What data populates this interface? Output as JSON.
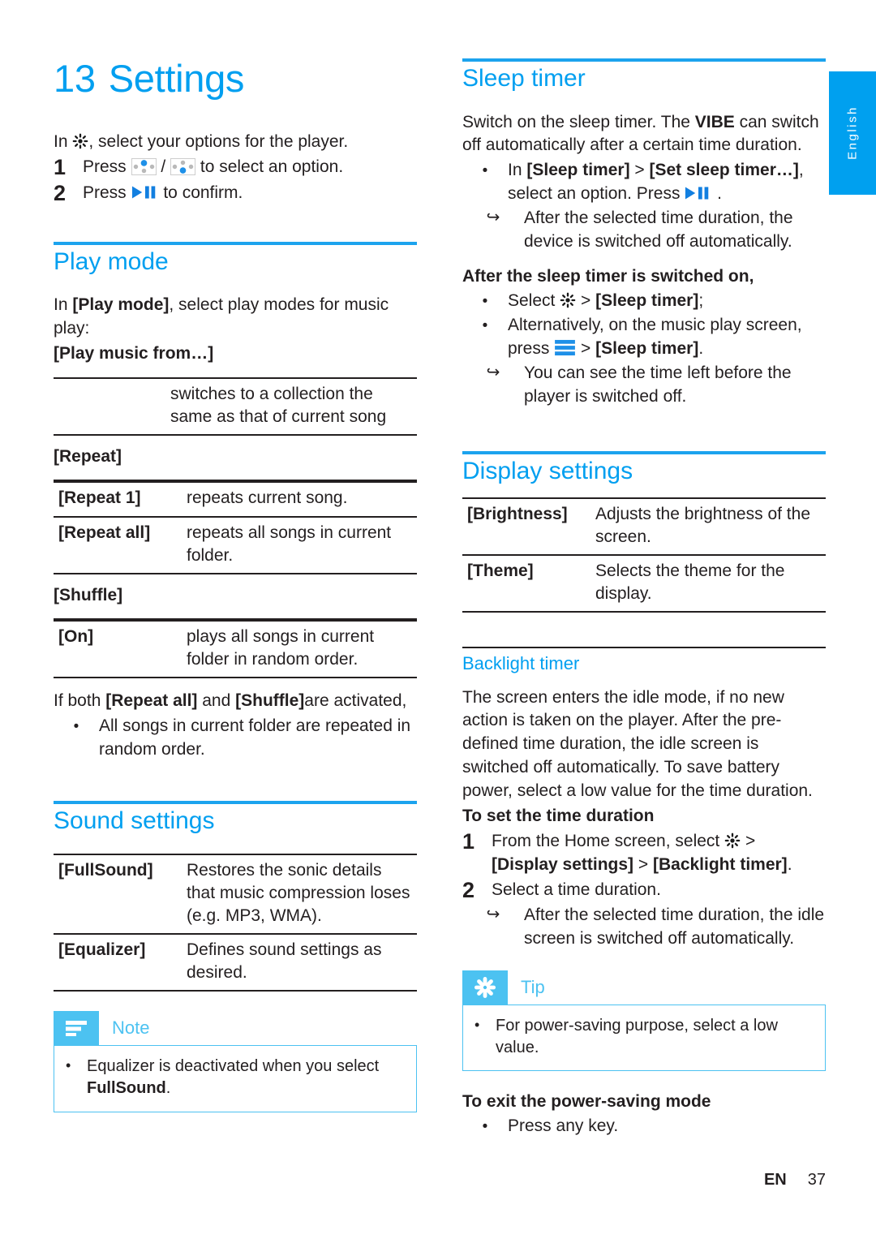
{
  "language_tab": {
    "label": "English"
  },
  "footer": {
    "language_code": "EN",
    "page_number": "37"
  },
  "left_column": {
    "chapter": {
      "number": "13",
      "title": "Settings"
    },
    "intro": {
      "lead_before": "In ",
      "lead_after": ", select your options for the player.",
      "gear_icon": "gear-icon",
      "steps": [
        {
          "number": "1",
          "text_before": "Press ",
          "icon_up": "dpad-up-icon",
          "separator": " / ",
          "icon_down": "dpad-down-icon",
          "text_after": " to select an option."
        },
        {
          "number": "2",
          "text_before": "Press ",
          "icon": "play-pause-icon",
          "text_after": " to confirm."
        }
      ]
    },
    "play_mode": {
      "title": "Play mode",
      "intro_before": "In ",
      "intro_bold": "[Play mode]",
      "intro_after": ", select play modes for music play:",
      "group_label_1": "[Play music from…]",
      "table_1": [
        {
          "key": "",
          "value": "switches to a collection the same as that of current song"
        }
      ],
      "group_label_2": "[Repeat]",
      "table_2": [
        {
          "key": "[Repeat 1]",
          "value": "repeats current song."
        },
        {
          "key": "[Repeat all]",
          "value": "repeats all songs in current folder."
        }
      ],
      "group_label_3": "[Shuffle]",
      "table_3": [
        {
          "key": "[On]",
          "value": "plays all songs in current folder in random order."
        }
      ],
      "combined_note": {
        "prefix": "If both ",
        "bold_1": "[Repeat all]",
        "middle": " and ",
        "bold_2": "[Shuffle]",
        "suffix": "are activated,",
        "bullet": "All songs in current folder are repeated in random order."
      }
    },
    "sound_settings": {
      "title": "Sound settings",
      "table": [
        {
          "key": "[FullSound]",
          "value": "Restores the sonic details that music compression loses (e.g. MP3, WMA)."
        },
        {
          "key": "[Equalizer]",
          "value": "Defines sound settings as desired."
        }
      ],
      "note": {
        "badge_icon": "note-lines-icon",
        "title": "Note",
        "text_before": "Equalizer is deactivated when you select ",
        "text_bold": "FullSound",
        "text_after": "."
      }
    }
  },
  "right_column": {
    "sleep_timer": {
      "title": "Sleep timer",
      "intro_before": "Switch on the sleep timer. The ",
      "intro_bold": "VIBE",
      "intro_after": " can switch off automatically after a certain time duration.",
      "bullet": {
        "text_1": "In ",
        "bold_1": "[Sleep timer]",
        "text_2": " > ",
        "bold_2": "[Set sleep timer…]",
        "text_3": ", select an option. Press ",
        "icon": "play-pause-icon",
        "text_4": " ."
      },
      "arrow_text": "After the selected time duration, the device is switched off automatically.",
      "after_heading": "After the sleep timer is switched on,",
      "bullets": [
        {
          "text_before": "Select ",
          "icon": "gear-icon",
          "text_middle": " > ",
          "bold": "[Sleep timer]",
          "text_after": ";"
        },
        {
          "text_before": "Alternatively, on the music play screen, press ",
          "icon": "menu-icon",
          "text_middle": " > ",
          "bold": "[Sleep timer]",
          "text_after": "."
        }
      ],
      "arrow_text_2": "You can see the time left before the player is switched off."
    },
    "display_settings": {
      "title": "Display settings",
      "table": [
        {
          "key": "[Brightness]",
          "value": "Adjusts the brightness of the screen."
        },
        {
          "key": "[Theme]",
          "value": "Selects the theme for the display."
        }
      ]
    },
    "backlight_timer": {
      "title": "Backlight timer",
      "paragraph": "The screen enters the idle mode, if no new action is taken on the player. After the pre-defined time duration, the idle screen is switched off automatically. To save battery power, select a low value for the time duration.",
      "heading": "To set the time duration",
      "steps": [
        {
          "number": "1",
          "text_before": "From the Home screen, select ",
          "icon": "gear-icon",
          "text_middle": " > ",
          "bold_1": "[Display settings]",
          "text_sep": " > ",
          "bold_2": "[Backlight timer]",
          "text_after": "."
        },
        {
          "number": "2",
          "text": "Select a time duration."
        }
      ],
      "arrow_text": "After the selected time duration, the idle screen is switched off automatically.",
      "tip": {
        "badge_icon": "tip-star-icon",
        "title": "Tip",
        "text": "For power-saving purpose, select a low value."
      },
      "exit_heading": "To exit the power-saving mode",
      "exit_bullet": "Press any key."
    }
  },
  "colors": {
    "accent_heading": "#009ff0",
    "accent_rule": "#1ca3ee",
    "callout": "#4cc2f1",
    "tab": "#00a0ef",
    "text": "#231f20"
  }
}
